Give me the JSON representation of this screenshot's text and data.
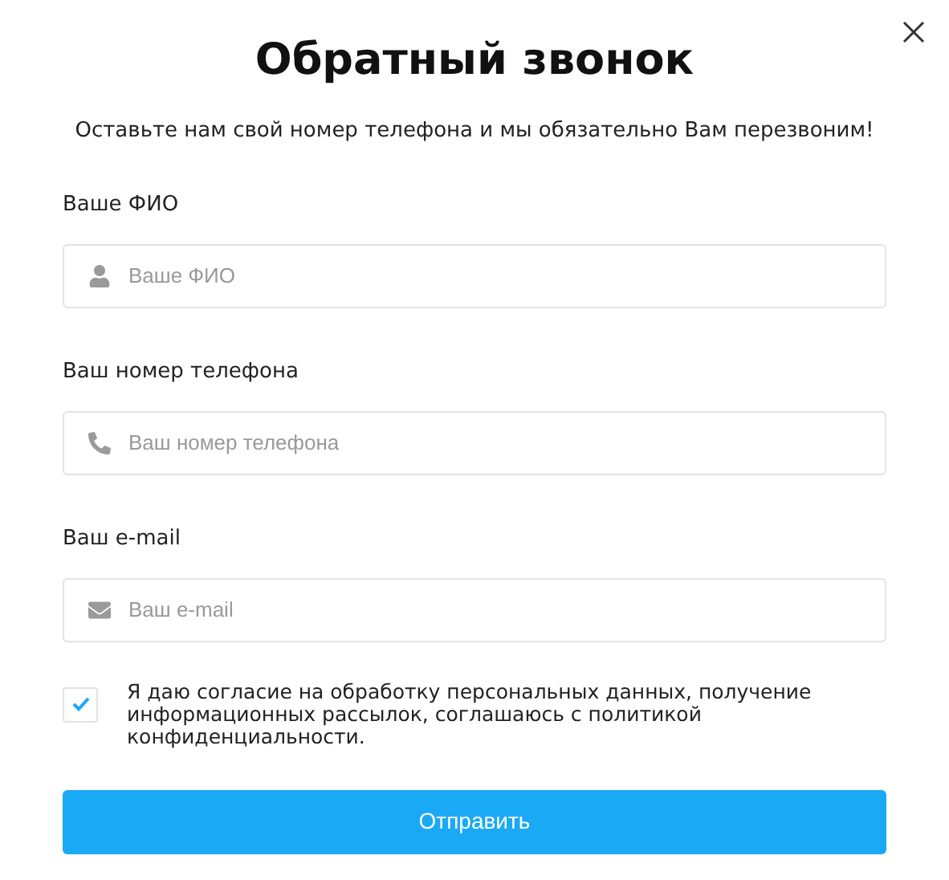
{
  "title": "Обратный звонок",
  "subtitle": "Оставьте нам свой номер телефона и мы обязательно Вам перезвоним!",
  "fields": [
    {
      "label": "Ваше ФИО",
      "placeholder": "Ваше ФИО",
      "kind": "person"
    },
    {
      "label": "Ваш номер телефона",
      "placeholder": "Ваш номер телефона",
      "kind": "phone"
    },
    {
      "label": "Ваш e-mail",
      "placeholder": "Ваш e-mail",
      "kind": "email"
    }
  ],
  "consent": {
    "text": "Я даю согласие на обработку персональных данных, получение информационных рассылок, соглашаюсь с политикой конфиденциальности.",
    "checked": true
  },
  "submit": "Отправить"
}
